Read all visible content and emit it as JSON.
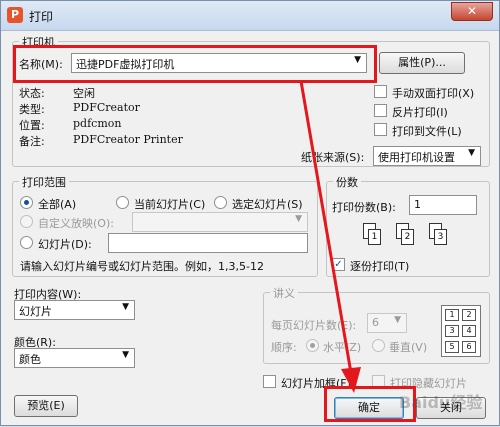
{
  "window": {
    "title": "打印",
    "app_icon_glyph": "P",
    "close_glyph": "✕"
  },
  "printer": {
    "group_title": "打印机",
    "name_label": "名称(M):",
    "name_value": "迅捷PDF虚拟打印机",
    "properties_button": "属性(P)...",
    "status_label": "状态:",
    "status_value": "空闲",
    "type_label": "类型:",
    "type_value": "PDFCreator",
    "location_label": "位置:",
    "location_value": "pdfcmon",
    "comment_label": "备注:",
    "comment_value": "PDFCreator Printer",
    "manual_duplex": "手动双面打印(X)",
    "reverse_print": "反片打印(I)",
    "print_to_file": "打印到文件(L)",
    "paper_source_label": "纸张来源(S):",
    "paper_source_value": "使用打印机设置"
  },
  "range": {
    "group_title": "打印范围",
    "all": "全部(A)",
    "current_slide": "当前幻灯片(C)",
    "selected_slides": "选定幻灯片(S)",
    "custom_show": "自定义放映(O):",
    "slides": "幻灯片(D):",
    "hint": "请输入幻灯片编号或幻灯片范围。例如，1,3,5-12"
  },
  "copies": {
    "group_title": "份数",
    "copies_label": "打印份数(B):",
    "copies_value": "1",
    "collate": "逐份打印(T)",
    "icon_pages": [
      "1",
      "2",
      "3"
    ]
  },
  "content": {
    "content_label": "打印内容(W):",
    "content_value": "幻灯片",
    "color_label": "颜色(R):",
    "color_value": "颜色"
  },
  "handout": {
    "group_title": "讲义",
    "per_page_label": "每页幻灯片数(E):",
    "per_page_value": "6",
    "order_label": "顺序:",
    "order_horizontal": "水平(Z)",
    "order_vertical": "垂直(V)",
    "grid_cells": [
      "1",
      "2",
      "3",
      "4",
      "5",
      "6"
    ]
  },
  "options": {
    "frame_slides": "幻灯片加框(F)",
    "print_hidden": "打印隐藏幻灯片"
  },
  "buttons": {
    "preview": "预览(E)",
    "ok": "确定",
    "close": "关闭"
  },
  "watermark": "Baidu经验"
}
